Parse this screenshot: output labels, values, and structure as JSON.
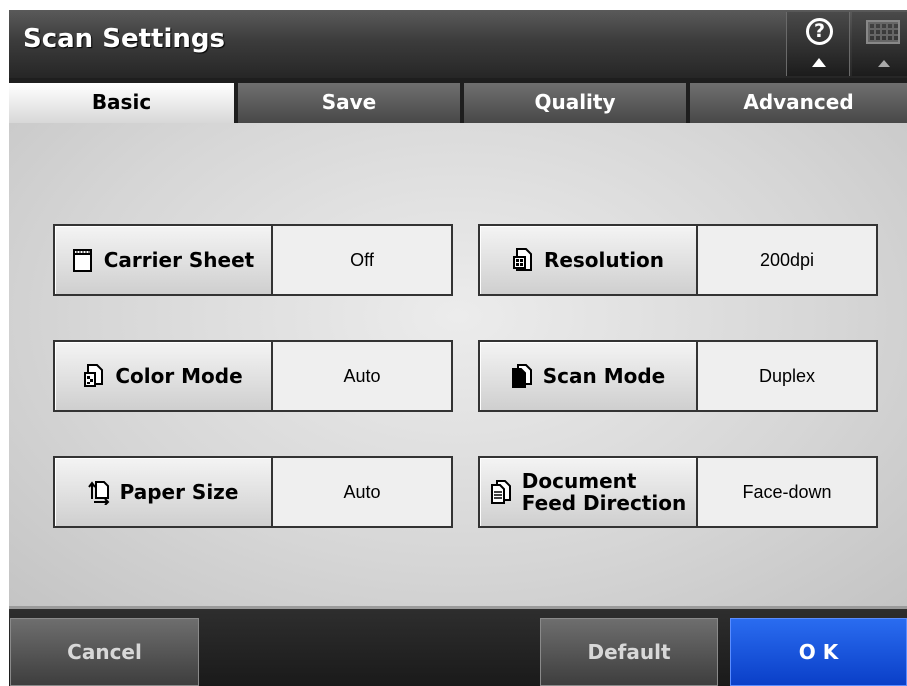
{
  "window": {
    "title": "Scan Settings"
  },
  "header_buttons": {
    "help": "help-icon",
    "keyboard": "keyboard-icon"
  },
  "tabs": [
    {
      "label": "Basic",
      "active": true
    },
    {
      "label": "Save",
      "active": false
    },
    {
      "label": "Quality",
      "active": false
    },
    {
      "label": "Advanced",
      "active": false
    }
  ],
  "settings": {
    "carrier_sheet": {
      "label": "Carrier Sheet",
      "value": "Off",
      "icon": "carrier-sheet-icon"
    },
    "color_mode": {
      "label": "Color Mode",
      "value": "Auto",
      "icon": "color-mode-icon"
    },
    "paper_size": {
      "label": "Paper Size",
      "value": "Auto",
      "icon": "paper-size-icon"
    },
    "resolution": {
      "label": "Resolution",
      "value": "200dpi",
      "icon": "resolution-icon"
    },
    "scan_mode": {
      "label": "Scan Mode",
      "value": "Duplex",
      "icon": "scan-mode-icon"
    },
    "document_feed_direction": {
      "label_line1": "Document",
      "label_line2": "Feed Direction",
      "value": "Face-down",
      "icon": "document-feed-icon"
    }
  },
  "footer": {
    "cancel_label": "Cancel",
    "default_label": "Default",
    "ok_label": "O K"
  },
  "colors": {
    "ok_button": "#1a55e0",
    "active_tab": "#f0f0f0",
    "titlebar": "#3c3c3c"
  }
}
